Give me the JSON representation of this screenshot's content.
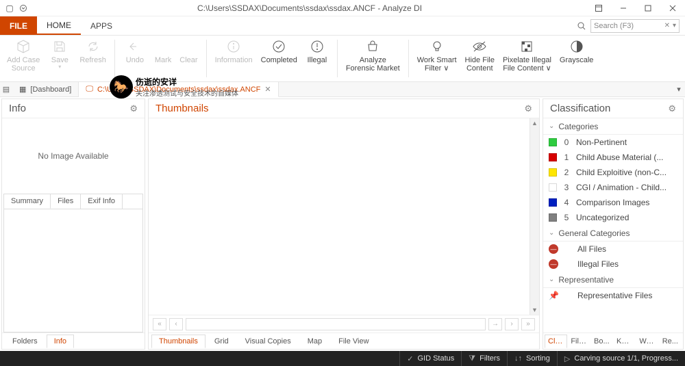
{
  "titlebar": {
    "title": "C:\\Users\\SSDAX\\Documents\\ssdax\\ssdax.ANCF - Analyze DI"
  },
  "menu": {
    "file": "FILE",
    "home": "HOME",
    "apps": "APPS",
    "search_placeholder": "Search (F3)"
  },
  "ribbon": {
    "add_case": "Add Case\nSource",
    "save": "Save",
    "refresh": "Refresh",
    "undo": "Undo",
    "mark": "Mark",
    "clear": "Clear",
    "information": "Information",
    "completed": "Completed",
    "illegal": "Illegal",
    "analyze": "Analyze\nForensic Market",
    "smart_filter": "Work Smart\nFilter ∨",
    "hide_file": "Hide File\nContent",
    "pixelate": "Pixelate Illegal\nFile Content ∨",
    "grayscale": "Grayscale"
  },
  "doctabs": {
    "dashboard": "[Dashboard]",
    "file": "C:\\Users\\SSDAX\\Documents\\ssdax\\ssdax.ANCF"
  },
  "info": {
    "title": "Info",
    "no_image": "No Image Available",
    "tabs": {
      "summary": "Summary",
      "files": "Files",
      "exif": "Exif Info"
    },
    "bottom": {
      "folders": "Folders",
      "info": "Info"
    }
  },
  "thumbs": {
    "title": "Thumbnails",
    "bottom": {
      "thumbnails": "Thumbnails",
      "grid": "Grid",
      "visual": "Visual Copies",
      "map": "Map",
      "fileview": "File View"
    }
  },
  "classification": {
    "title": "Classification",
    "sections": {
      "categories": "Categories",
      "general": "General Categories",
      "representative": "Representative"
    },
    "cats": [
      {
        "color": "#2ecc40",
        "num": "0",
        "label": "Non-Pertinent"
      },
      {
        "color": "#d60000",
        "num": "1",
        "label": "Child Abuse Material (..."
      },
      {
        "color": "#ffe600",
        "num": "2",
        "label": "Child Exploitive (non-C..."
      },
      {
        "color": "#ffffff",
        "num": "3",
        "label": "CGI / Animation - Child..."
      },
      {
        "color": "#0020c0",
        "num": "4",
        "label": "Comparison Images"
      },
      {
        "color": "#808080",
        "num": "5",
        "label": "Uncategorized"
      }
    ],
    "general_items": {
      "all": "All Files",
      "illegal": "Illegal Files"
    },
    "representative_item": "Representative Files",
    "bottom": [
      "Cla...",
      "Filt...",
      "Bo...",
      "Key...",
      "Wo...",
      "Re..."
    ]
  },
  "statusbar": {
    "gid": "GID Status",
    "filters": "Filters",
    "sorting": "Sorting",
    "carving": "Carving source 1/1, Progress..."
  },
  "watermark": {
    "main": "伤逝的安详",
    "sub": "关注渗透测试与安全技术的自媒体"
  }
}
